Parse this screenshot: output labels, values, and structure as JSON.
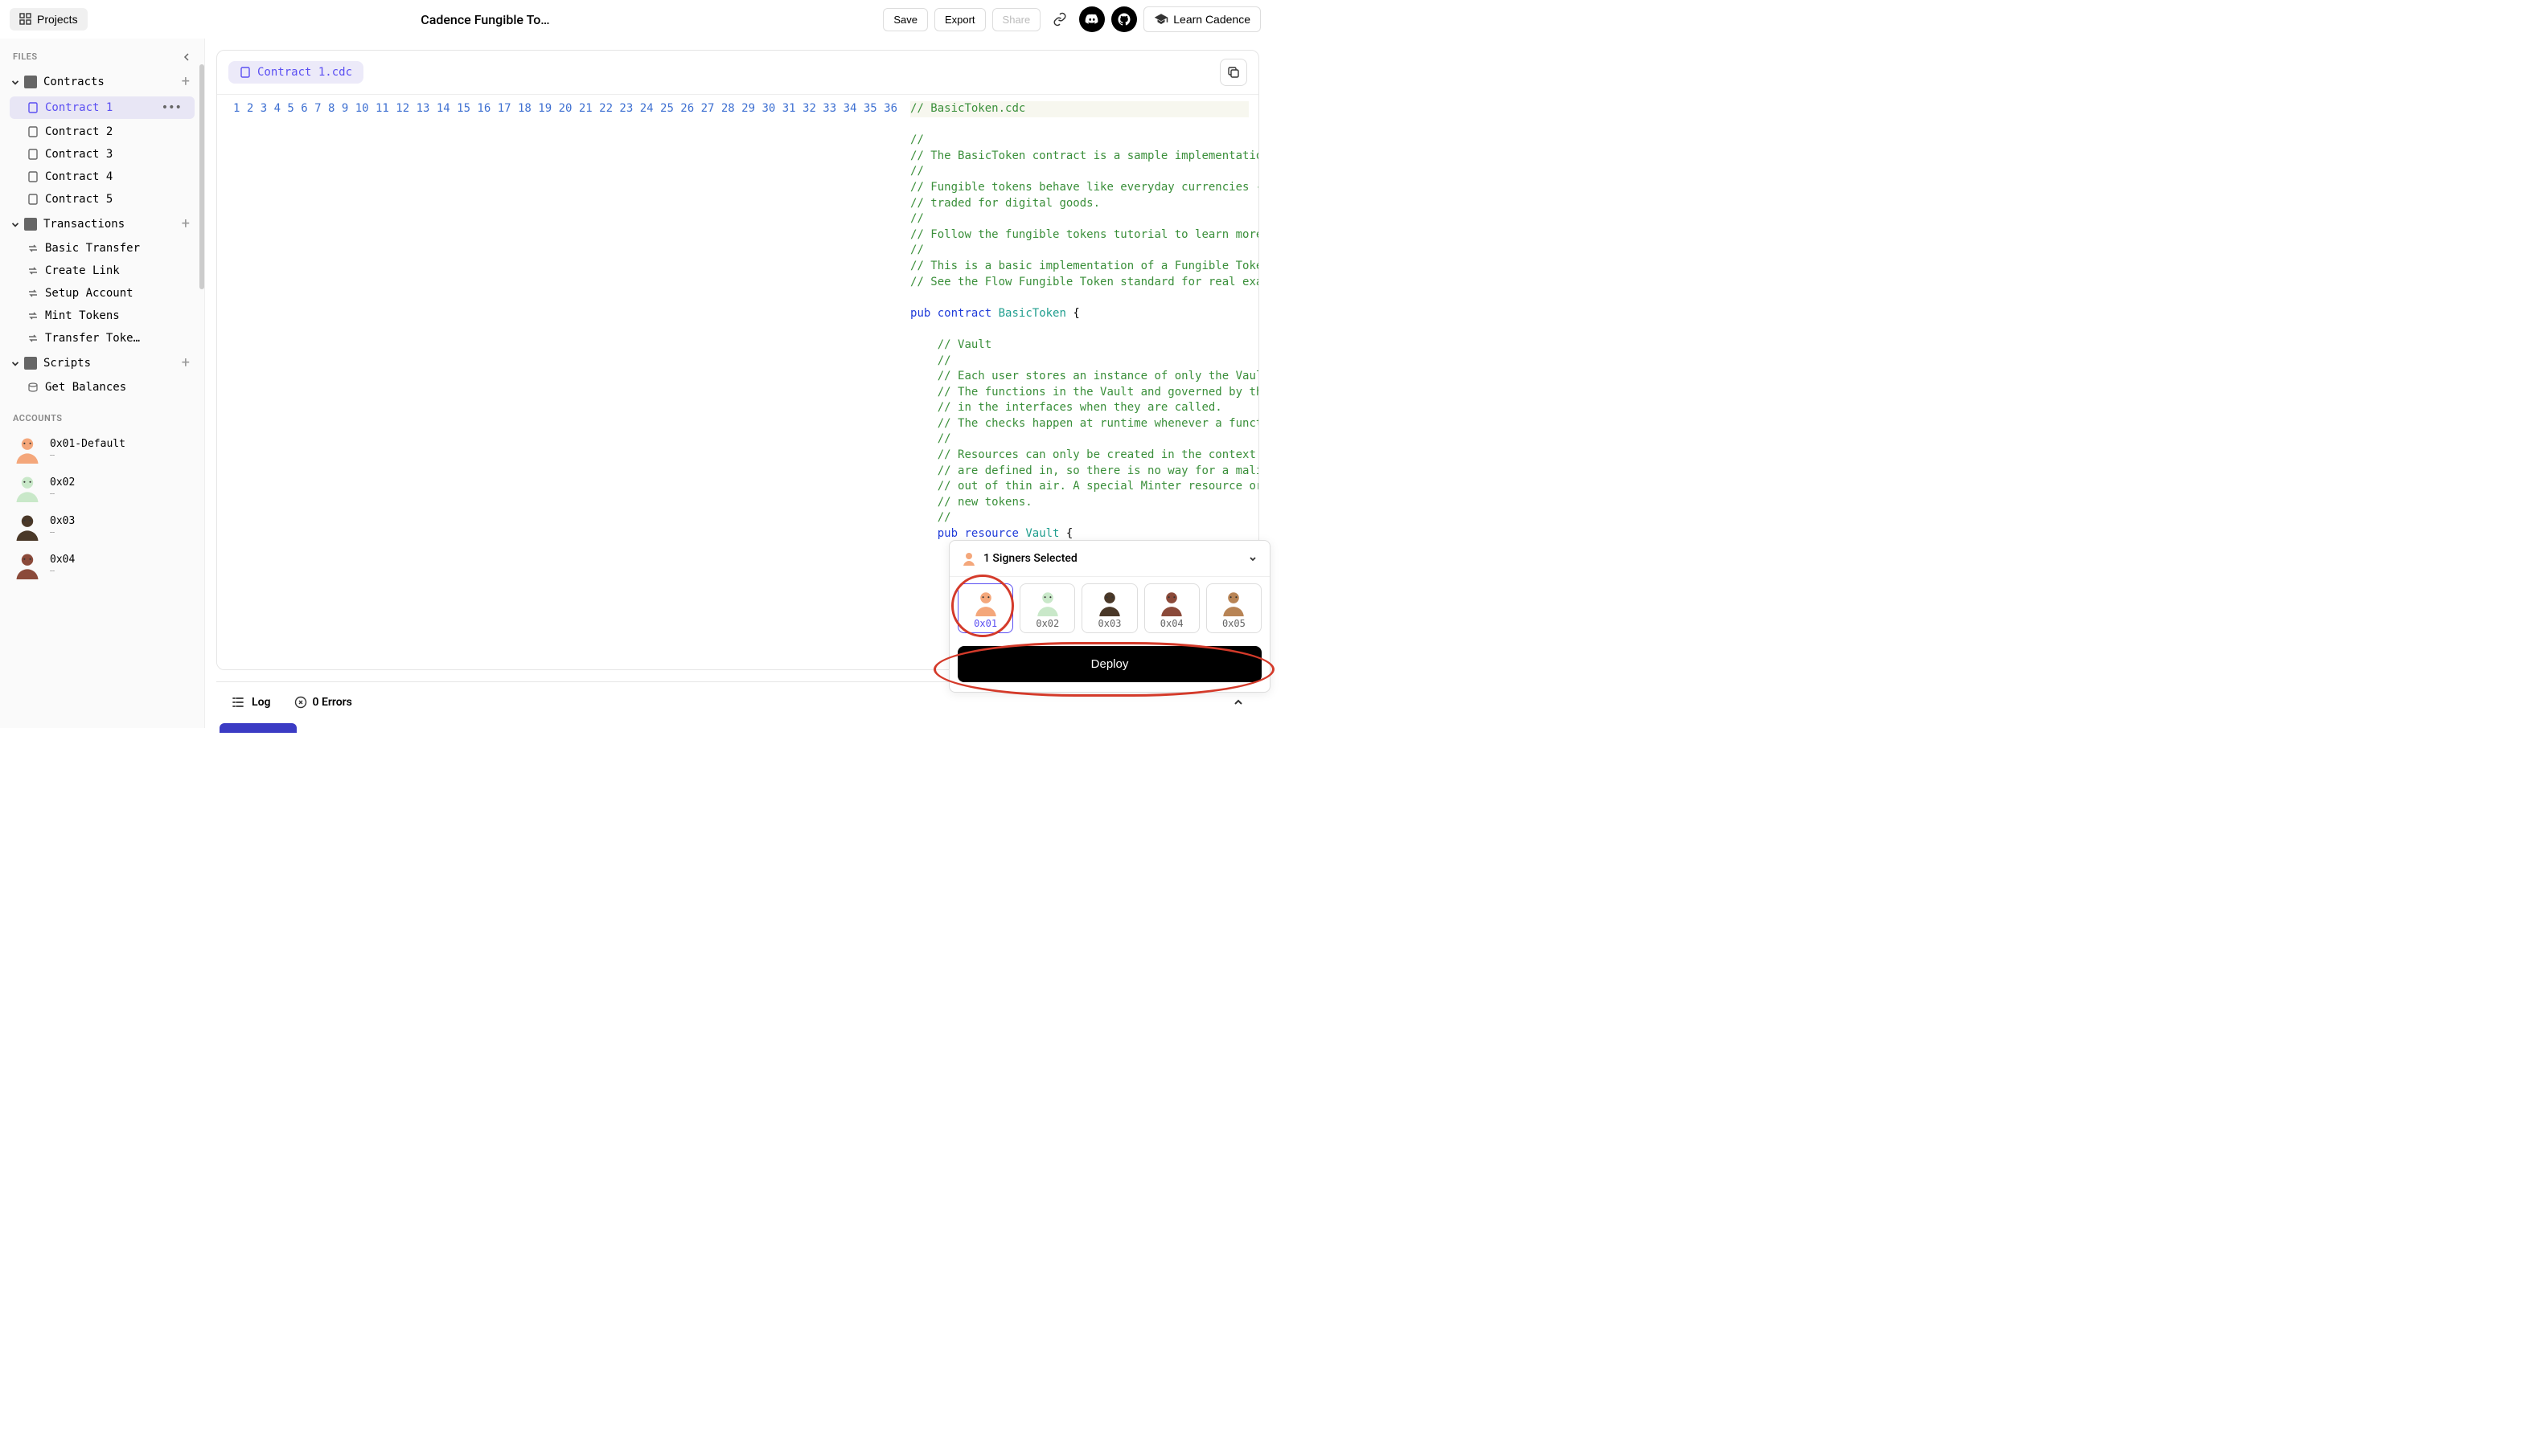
{
  "header": {
    "projects_label": "Projects",
    "title": "Cadence Fungible To…",
    "save": "Save",
    "export": "Export",
    "share": "Share",
    "learn": "Learn Cadence"
  },
  "sidebar": {
    "files_label": "FILES",
    "folders": {
      "contracts": "Contracts",
      "transactions": "Transactions",
      "scripts": "Scripts"
    },
    "contracts": [
      "Contract 1",
      "Contract 2",
      "Contract 3",
      "Contract 4",
      "Contract 5"
    ],
    "active_contract_index": 0,
    "transactions": [
      "Basic Transfer",
      "Create Link",
      "Setup Account",
      "Mint Tokens",
      "Transfer Toke…"
    ],
    "scripts": [
      "Get Balances"
    ],
    "accounts_label": "ACCOUNTS",
    "accounts": [
      {
        "name": "0x01-Default",
        "sub": "--",
        "color": "#f4a77b"
      },
      {
        "name": "0x02",
        "sub": "--",
        "color": "#c9e8c9"
      },
      {
        "name": "0x03",
        "sub": "--",
        "color": "#4a3828"
      },
      {
        "name": "0x04",
        "sub": "--",
        "color": "#8b4a3a"
      }
    ]
  },
  "editor": {
    "tab_name": "Contract 1.cdc",
    "line_count": 36
  },
  "bottom": {
    "log": "Log",
    "errors": "0 Errors"
  },
  "signers": {
    "title": "1 Signers Selected",
    "accounts": [
      {
        "name": "0x01",
        "color": "#f4a77b",
        "selected": true
      },
      {
        "name": "0x02",
        "color": "#c9e8c9",
        "selected": false
      },
      {
        "name": "0x03",
        "color": "#4a3828",
        "selected": false
      },
      {
        "name": "0x04",
        "color": "#8b4a3a",
        "selected": false
      },
      {
        "name": "0x05",
        "color": "#b88455",
        "selected": false
      }
    ],
    "deploy": "Deploy"
  }
}
